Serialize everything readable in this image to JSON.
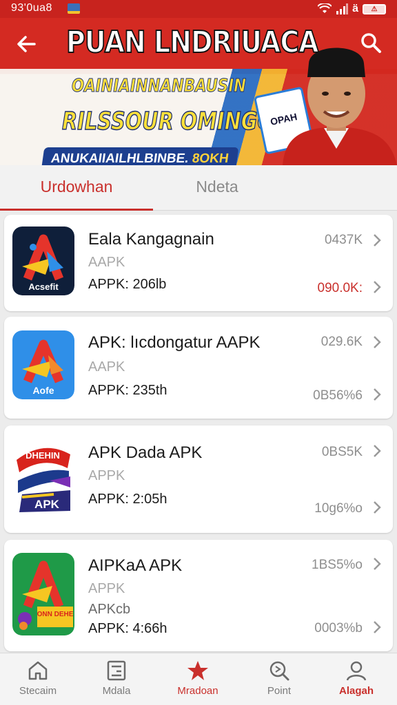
{
  "status_bar": {
    "time": "93'0ua8",
    "signal_number": "ä",
    "battery": "⚠"
  },
  "header": {
    "title": "PUAN LNDRIUACA",
    "line1": "OAINIAINNANBAUSIN",
    "line2": "RILSSOUR OMINGOA!",
    "badge_text": "ANUKAIIAILHLBINBE.",
    "badge_accent": "8OKH",
    "card_text": "OPAH"
  },
  "tabs": [
    {
      "label": "Urdowhan",
      "active": true
    },
    {
      "label": "Ndeta",
      "active": false
    }
  ],
  "apps": [
    {
      "title": "Eala Kangagnain",
      "subtitle": "AAPK",
      "meta": "APPK: 206lb",
      "stat_top": "0437K",
      "stat_bottom": "090.0K:",
      "stat_bottom_color": "red",
      "icon_label": "Acsefit",
      "icon_colors": [
        "#0f1f3a",
        "#e5342b",
        "#f6c622"
      ]
    },
    {
      "title": "APK: lıcdongatur AAPK",
      "subtitle": "AAPK",
      "meta": "APPK: 235th",
      "stat_top": "029.6K",
      "stat_bottom": "0B56%6",
      "stat_bottom_color": "grey",
      "icon_label": "Aofe",
      "icon_colors": [
        "#2f8fe8",
        "#e5342b",
        "#f6c622"
      ]
    },
    {
      "title": "APK Dada APK",
      "subtitle": "APPK",
      "meta": "APPK: 2:05h",
      "stat_top": "0BS5K",
      "stat_bottom": "10g6%o",
      "stat_bottom_color": "grey",
      "icon_label": "APK",
      "icon_banner": "DHEHIN",
      "icon_colors": [
        "#ffffff",
        "#d8241d",
        "#1c3a8c"
      ]
    },
    {
      "title": "AIPKaA APK",
      "subtitle": "APPK",
      "extra": "APKcb",
      "meta": "APPK: 4:66h",
      "stat_top": "1BS5%o",
      "stat_bottom": "0003%b",
      "stat_bottom_color": "grey",
      "icon_label": "ONN DEHE",
      "icon_colors": [
        "#1f9a48",
        "#e5342b",
        "#f6c622"
      ]
    }
  ],
  "bottom_nav": [
    {
      "label": "Stecaim",
      "icon": "home-icon",
      "state": "normal"
    },
    {
      "label": "Mdala",
      "icon": "news-icon",
      "state": "normal"
    },
    {
      "label": "Mradoan",
      "icon": "star-icon",
      "state": "active"
    },
    {
      "label": "Point",
      "icon": "search-icon",
      "state": "normal"
    },
    {
      "label": "Alagah",
      "icon": "profile-icon",
      "state": "bold"
    }
  ],
  "colors": {
    "brand_red": "#c9302c",
    "header_red": "#d42a22",
    "banner_yellow": "#ffe03a",
    "navy": "#1d3f8f"
  }
}
